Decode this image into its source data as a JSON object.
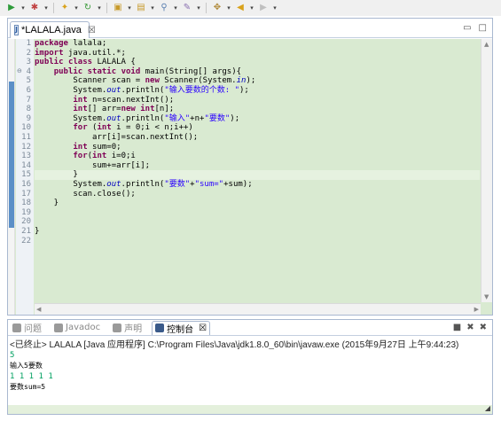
{
  "toolbar": {
    "buttons": [
      {
        "name": "run-icon",
        "color": "#2e9b3a"
      },
      {
        "name": "debug-icon",
        "color": "#c04040"
      },
      {
        "name": "new-icon",
        "color": "#d9a21b"
      },
      {
        "name": "refresh-icon",
        "color": "#3a9a3a"
      },
      {
        "name": "package-icon",
        "color": "#c79a2b"
      },
      {
        "name": "open-type-icon",
        "color": "#c79a2b"
      },
      {
        "name": "search-icon",
        "color": "#5a7fb0"
      },
      {
        "name": "annotation-icon",
        "color": "#8a6fb0"
      },
      {
        "name": "pin-icon",
        "color": "#b08a3a"
      },
      {
        "name": "back-icon",
        "color": "#d9a21b"
      },
      {
        "name": "forward-icon",
        "color": "#c0c0c0"
      }
    ]
  },
  "editor": {
    "tab_label": "*LALALA.java",
    "tab_close": "☒",
    "lines": [
      {
        "n": "1",
        "html": "<span class='kw'>package</span> lalala;"
      },
      {
        "n": "2",
        "html": "<span class='kw'>import</span> java.util.*;"
      },
      {
        "n": "3",
        "html": "<span class='kw'>public</span> <span class='kw'>class</span> LALALA {"
      },
      {
        "n": "4",
        "html": "    <span class='kw'>public</span> <span class='kw'>static</span> <span class='kw'>void</span> main(String[] args){"
      },
      {
        "n": "5",
        "html": "        Scanner scan = <span class='kw'>new</span> Scanner(System.<span class='fld'>in</span>);"
      },
      {
        "n": "6",
        "html": "        System.<span class='fld'>out</span>.println(<span class='str'>\"输入要数的个数: \"</span>);"
      },
      {
        "n": "7",
        "html": "        <span class='kw'>int</span> n=scan.nextInt();"
      },
      {
        "n": "8",
        "html": "        <span class='kw'>int</span>[] arr=<span class='kw'>new</span> <span class='kw'>int</span>[n];"
      },
      {
        "n": "9",
        "html": "        System.<span class='fld'>out</span>.println(<span class='str'>\"输入\"</span>+n+<span class='str'>\"要数\"</span>);"
      },
      {
        "n": "10",
        "html": "        <span class='kw'>for</span> (<span class='kw'>int</span> i = 0;i < n;i++)"
      },
      {
        "n": "11",
        "html": "            arr[i]=scan.nextInt();"
      },
      {
        "n": "12",
        "html": "        <span class='kw'>int</span> sum=0;"
      },
      {
        "n": "13",
        "html": "        <span class='kw'>for</span>(<span class='kw'>int</span> i=0;i<n;i++){"
      },
      {
        "n": "14",
        "html": "            sum+=arr[i];"
      },
      {
        "n": "15",
        "html": "        }"
      },
      {
        "n": "16",
        "html": "        System.<span class='fld'>out</span>.println(<span class='str'>\"要数\"</span>+<span class='str'>\"sum=\"</span>+sum);"
      },
      {
        "n": "17",
        "html": "        scan.close();"
      },
      {
        "n": "18",
        "html": "    }"
      },
      {
        "n": "19",
        "html": ""
      },
      {
        "n": "20",
        "html": ""
      },
      {
        "n": "21",
        "html": "}"
      },
      {
        "n": "22",
        "html": ""
      }
    ],
    "current_line": "15"
  },
  "console": {
    "tabs": [
      {
        "label": "问题",
        "icon": "problems-icon",
        "color": "#9a9a9a",
        "active": false
      },
      {
        "label": "Javadoc",
        "icon": "javadoc-icon",
        "color": "#9a9a9a",
        "active": false
      },
      {
        "label": "声明",
        "icon": "declaration-icon",
        "color": "#9a9a9a",
        "active": false
      },
      {
        "label": "控制台",
        "icon": "console-icon",
        "color": "#3a5a8a",
        "active": true
      }
    ],
    "tab_close": "☒",
    "status": "<已终止> LALALA [Java 应用程序] C:\\Program Files\\Java\\jdk1.8.0_60\\bin\\javaw.exe (2015年9月27日 上午9:44:23)",
    "output": [
      {
        "text": "5",
        "style": "green"
      },
      {
        "text": "输入5要数",
        "style": "black"
      },
      {
        "text": "1 1 1 1 1",
        "style": "green"
      },
      {
        "text": "要数sum=5",
        "style": "black"
      }
    ]
  }
}
